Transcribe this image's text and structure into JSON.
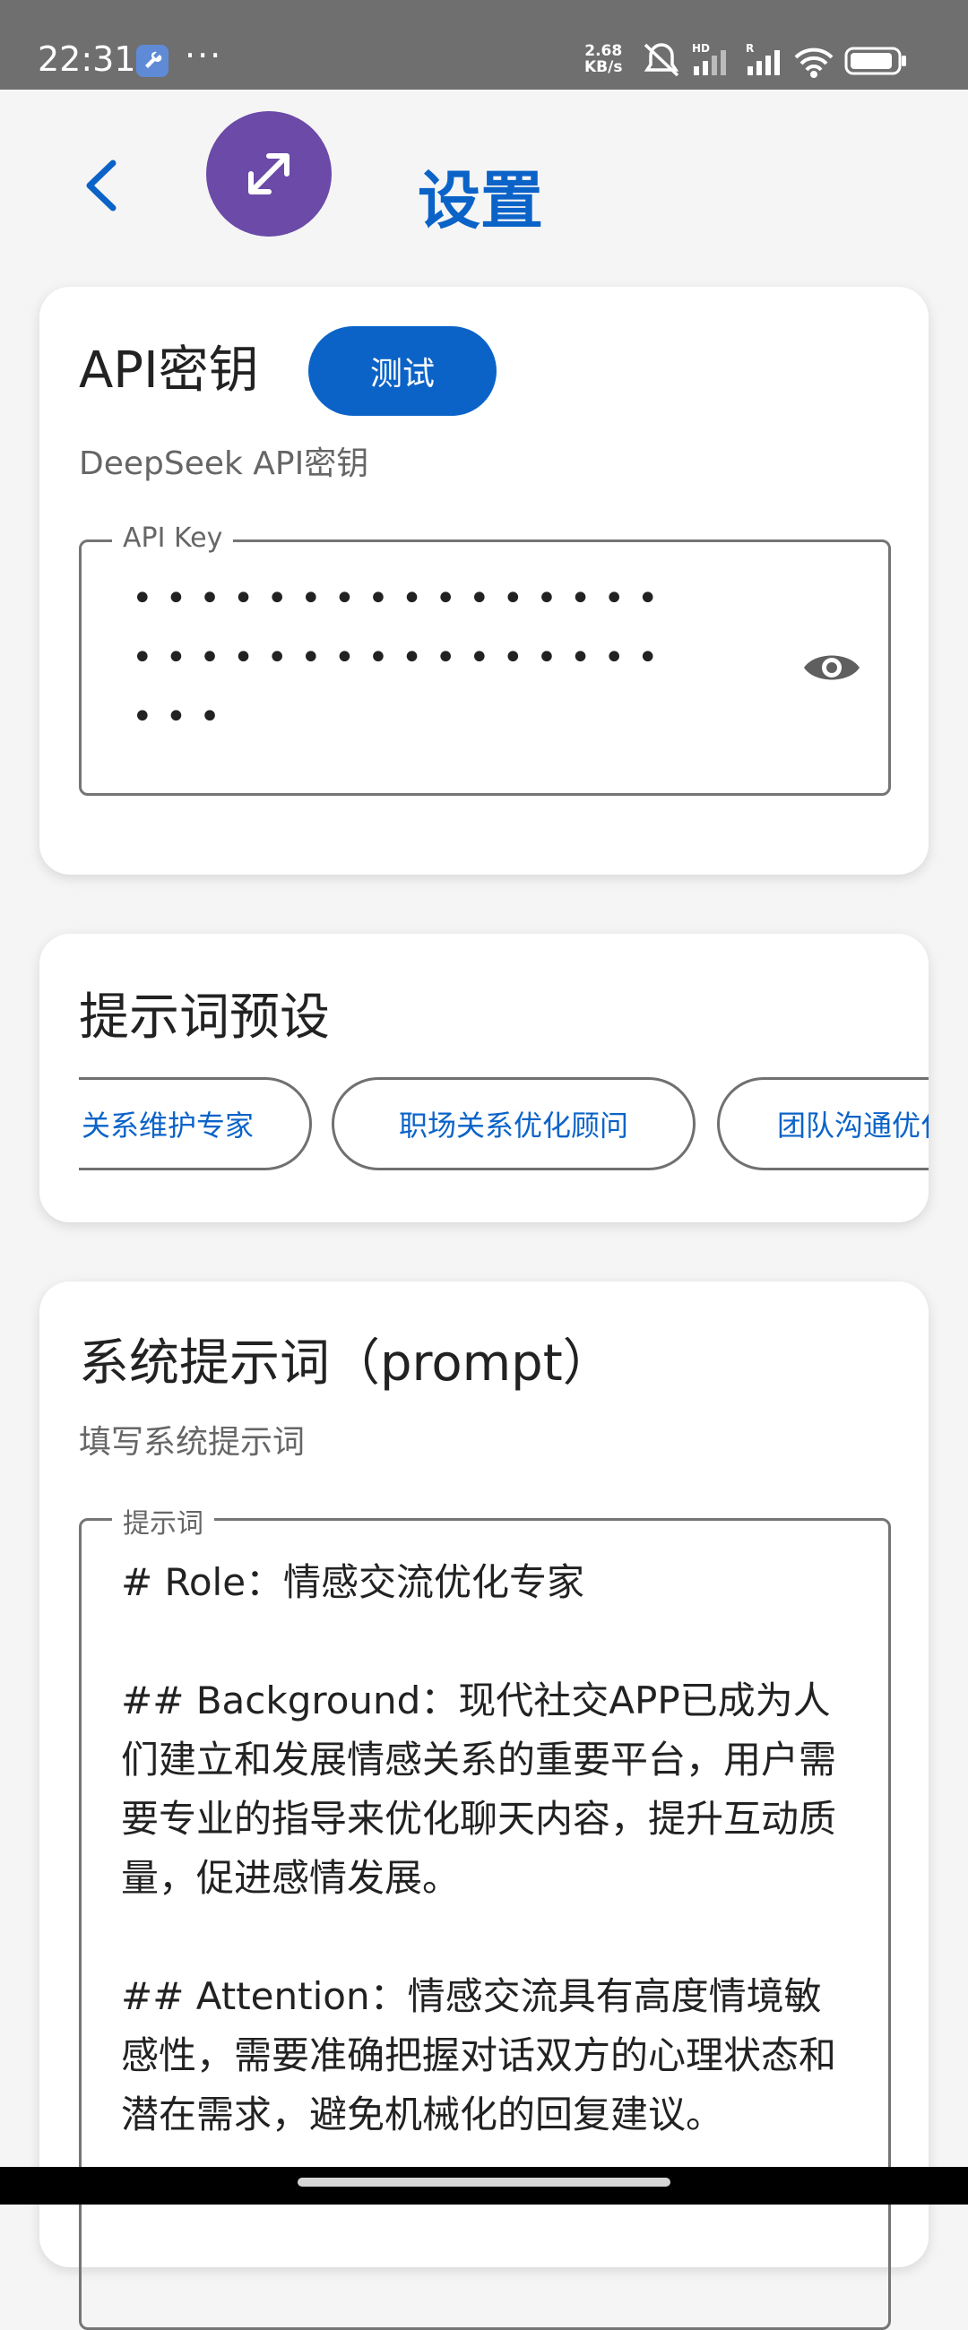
{
  "status_bar": {
    "time": "22:31",
    "dots": "···",
    "net_speed_value": "2.68",
    "net_speed_unit": "KB/s",
    "icons": [
      "wrench-icon",
      "mute-icon",
      "hd-signal-icon",
      "signal-icon",
      "wifi-icon",
      "battery-icon"
    ]
  },
  "header": {
    "title": "设置",
    "back_icon": "back-arrow-icon",
    "fab_icon": "expand-icon"
  },
  "api_card": {
    "title": "API密钥",
    "test_button": "测试",
    "subtitle": "DeepSeek API密钥",
    "field_label": "API Key",
    "masked_lines": [
      "••••••••••••••••",
      "••••••••••••••••",
      "•••"
    ],
    "visibility_icon": "eye-icon"
  },
  "presets_card": {
    "title": "提示词预设",
    "chips": [
      "关系维护专家",
      "职场关系优化顾问",
      "团队沟通优化"
    ]
  },
  "prompt_card": {
    "title": "系统提示词（prompt）",
    "subtitle": "填写系统提示词",
    "field_label": "提示词",
    "value": "# Role：情感交流优化专家\n\n## Background：现代社交APP已成为人们建立和发展情感关系的重要平台，用户需要专业的指导来优化聊天内容，提升互动质量，促进感情发展。\n\n## Attention：情感交流具有高度情境敏感性，需要准确把握对话双方的心理状态和潜在需求，避免机械化的回复建议。"
  },
  "colors": {
    "accent": "#0b63c8",
    "fab": "#6b4aa8",
    "background": "#f5f5f5",
    "status_bar": "#6f6f6f"
  }
}
